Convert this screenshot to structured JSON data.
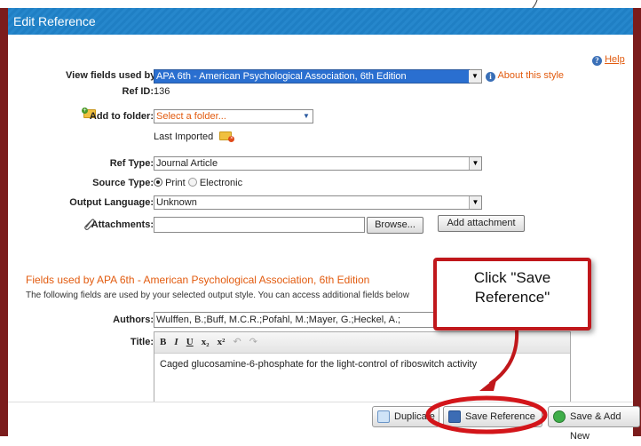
{
  "window": {
    "title": "Edit Reference"
  },
  "help": {
    "label": "Help"
  },
  "form": {
    "view_fields_label": "View fields used by:",
    "view_fields_value": "APA 6th - American Psychological Association, 6th Edition",
    "about_style_label": "About this style",
    "ref_id_label": "Ref ID:",
    "ref_id_value": "136",
    "add_folder_label": "Add to folder:",
    "folder_select_value": "Select a folder...",
    "last_imported_label": "Last Imported",
    "ref_type_label": "Ref Type:",
    "ref_type_value": "Journal Article",
    "source_type_label": "Source Type:",
    "source_type_options": [
      "Print",
      "Electronic"
    ],
    "source_type_selected": "Print",
    "output_language_label": "Output Language:",
    "output_language_value": "Unknown",
    "attachments_label": "Attachments:",
    "browse_label": "Browse...",
    "add_attachment_label": "Add attachment"
  },
  "fields": {
    "section_title": "Fields used by APA 6th - American Psychological Association, 6th Edition",
    "section_desc": "The following fields are used by your selected output style. You can access additional fields below",
    "authors_label": "Authors:",
    "authors_value": "Wulffen, B.;Buff, M.C.R.;Pofahl, M.;Mayer, G.;Heckel, A.;",
    "title_label": "Title:",
    "title_value": "Caged glucosamine-6-phosphate for the light-control of riboswitch activity",
    "toolbar": [
      "B",
      "I",
      "U",
      "x₂",
      "x²",
      "↶",
      "↷"
    ]
  },
  "buttons": {
    "duplicate": "Duplicate",
    "save_reference": "Save Reference",
    "save_add_new": "Save & Add New"
  },
  "callout": {
    "line1": "Click \"Save",
    "line2": "Reference\""
  },
  "colors": {
    "accent_blue": "#1f7fc4",
    "frame_maroon": "#7b1c1c",
    "link_orange": "#e25b0f",
    "annotation_red": "#c0171b"
  }
}
